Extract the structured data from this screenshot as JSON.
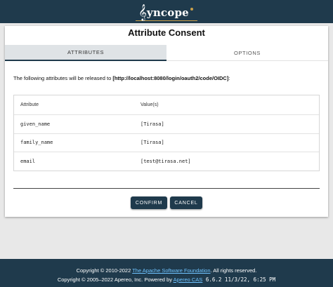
{
  "header": {
    "logo_clef": "𝄞",
    "logo_text": "yncope"
  },
  "card": {
    "title": "Attribute Consent",
    "tabs": [
      {
        "label": "ATTRIBUTES",
        "active": true
      },
      {
        "label": "OPTIONS",
        "active": false
      }
    ],
    "intro_prefix": "The following attributes will be released to ",
    "intro_target": "[http://localhost:8080/login/oauth2/code/OIDC]",
    "intro_suffix": ":",
    "table": {
      "headers": [
        "Attribute",
        "Value(s)"
      ],
      "rows": [
        {
          "name": "given_name",
          "value": "[Tirasa]"
        },
        {
          "name": "family_name",
          "value": "[Tirasa]"
        },
        {
          "name": "email",
          "value": "[test@tirasa.net]"
        }
      ]
    },
    "confirm_label": "CONFIRM",
    "cancel_label": "CANCEL"
  },
  "footer": {
    "line1_prefix": "Copyright © 2010-2022 ",
    "line1_link": "The Apache Software Foundation",
    "line1_suffix": ". All rights reserved.",
    "line2_prefix": "Copyright © 2005–2022 Apereo, Inc. Powered by ",
    "line2_link": "Apereo CAS",
    "line2_version": " 6.6.2 11/3/22, 6:25 PM"
  },
  "colors": {
    "brand_dark": "#1f3a4c",
    "accent_gold": "#c9a04a",
    "link": "#6fc3ff"
  }
}
